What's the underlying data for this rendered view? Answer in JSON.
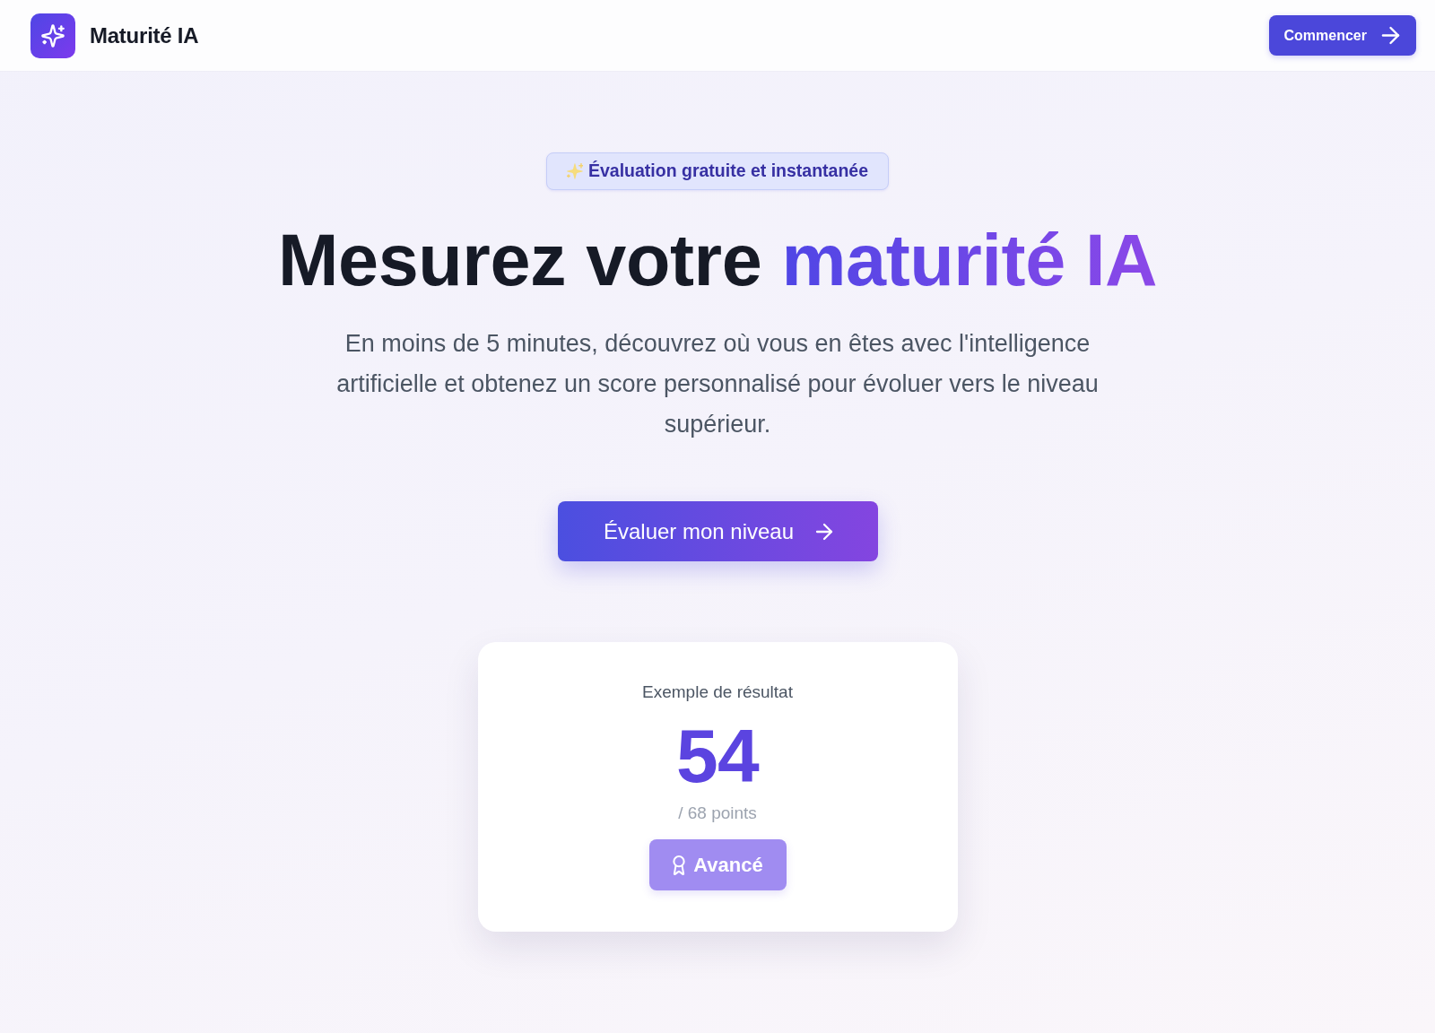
{
  "header": {
    "brand": "Maturité IA",
    "button": "Commencer"
  },
  "hero": {
    "pill": "Évaluation gratuite et instantanée",
    "title_start": "Mesurez votre",
    "title_highlight": "maturité IA",
    "subtitle": "En moins de 5 minutes, découvrez où vous en êtes avec l'intelligence artificielle et obtenez un score personnalisé pour évoluer vers le niveau supérieur.",
    "cta": "Évaluer mon niveau"
  },
  "result_card": {
    "label": "Exemple de résultat",
    "score": "54",
    "total": "/ 68 points",
    "tier": "Avancé"
  }
}
